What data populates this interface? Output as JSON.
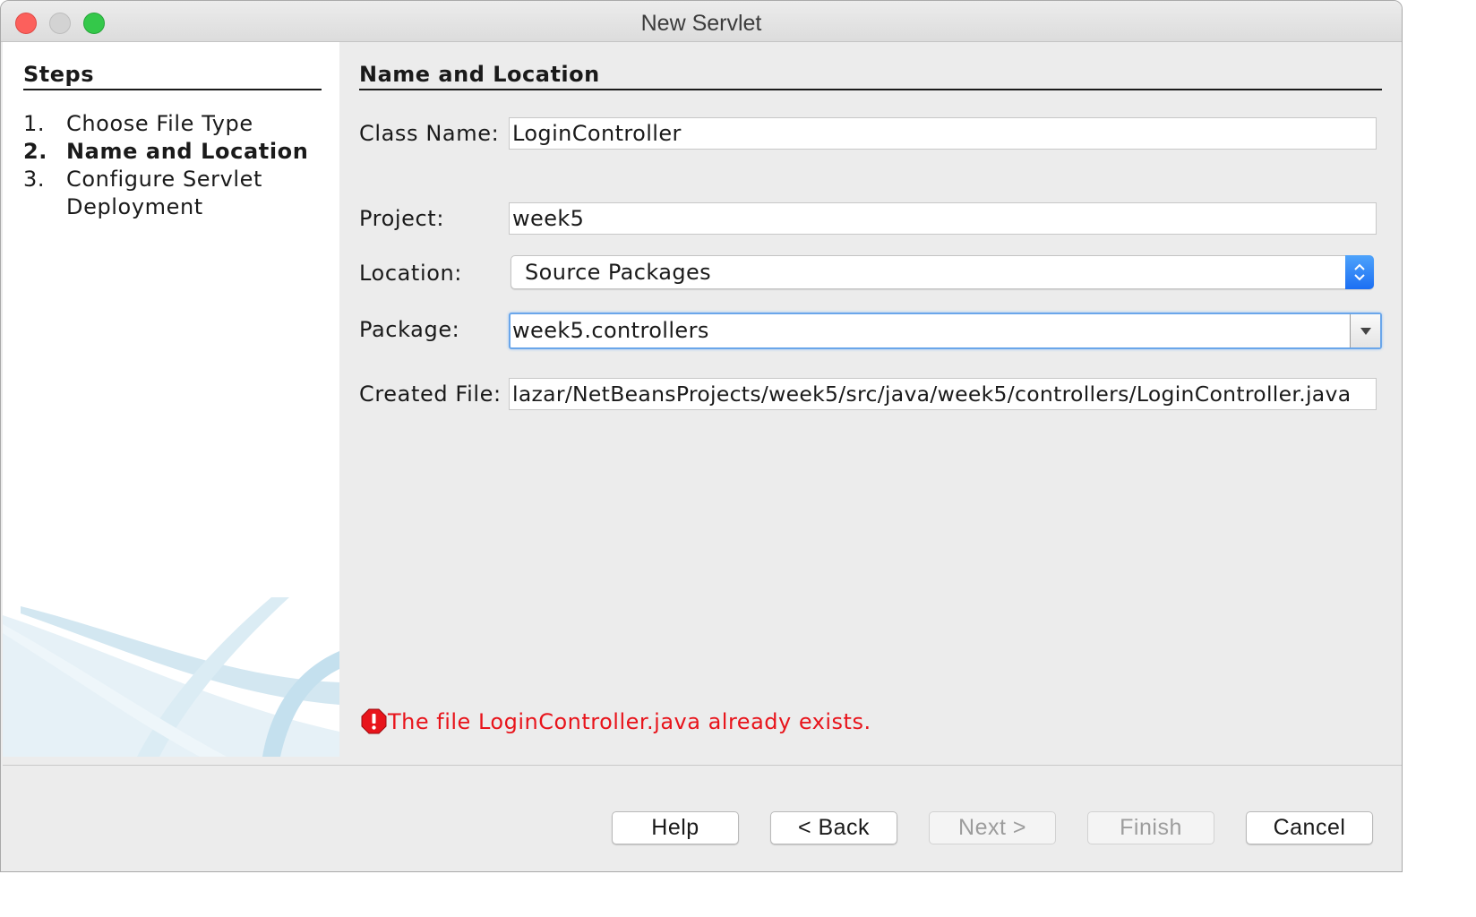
{
  "window": {
    "title": "New Servlet"
  },
  "steps": {
    "heading": "Steps",
    "items": [
      {
        "num": "1.",
        "label": "Choose File Type",
        "current": false
      },
      {
        "num": "2.",
        "label": "Name and Location",
        "current": true
      },
      {
        "num": "3.",
        "label": "Configure Servlet",
        "label_line2": "Deployment",
        "current": false
      }
    ]
  },
  "form": {
    "heading": "Name and Location",
    "class_name": {
      "label": "Class Name:",
      "value": "LoginController"
    },
    "project": {
      "label": "Project:",
      "value": "week5"
    },
    "location": {
      "label": "Location:",
      "value": "Source Packages"
    },
    "package": {
      "label": "Package:",
      "value": "week5.controllers"
    },
    "created_file": {
      "label": "Created File:",
      "value": "lazar/NetBeansProjects/week5/src/java/week5/controllers/LoginController.java"
    }
  },
  "error": {
    "message": "The file LoginController.java already exists.",
    "color": "#e8141b",
    "icon": "error-icon"
  },
  "buttons": {
    "help": "Help",
    "back": "< Back",
    "next": "Next >",
    "finish": "Finish",
    "cancel": "Cancel"
  },
  "colors": {
    "accent": "#1c6ff3",
    "focus": "#6aa6ea"
  }
}
